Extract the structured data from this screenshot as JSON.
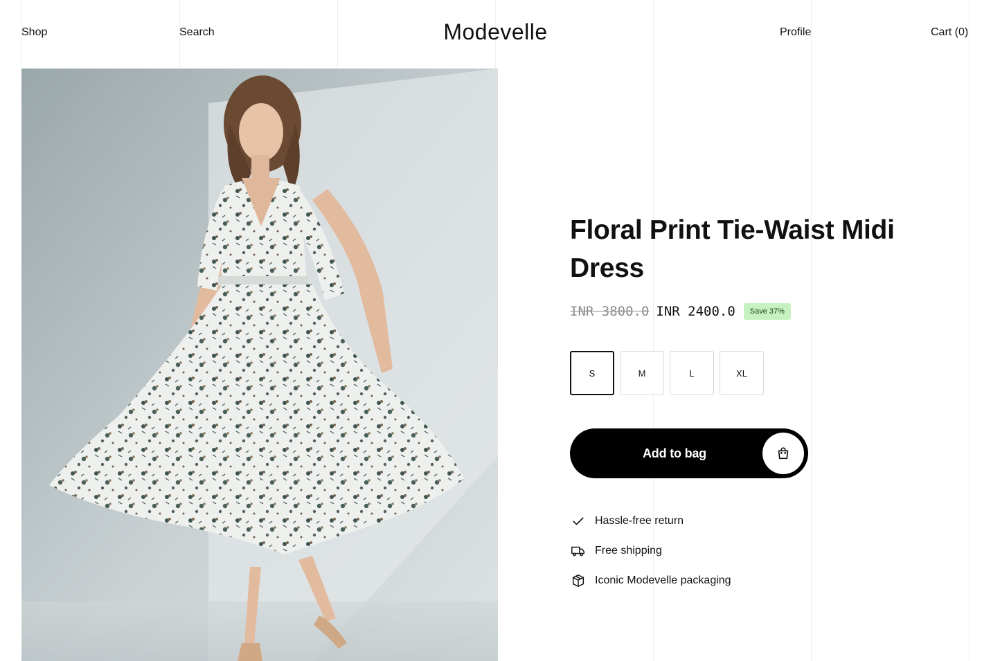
{
  "header": {
    "nav_left": [
      "Shop",
      "Search"
    ],
    "brand": "Modevelle",
    "nav_right": [
      "Profile",
      "Cart (0)"
    ]
  },
  "product": {
    "title": "Floral Print Tie-Waist Midi Dress",
    "price_original": "INR 3800.0",
    "price_current": "INR 2400.0",
    "save_badge": "Save 37%",
    "sizes": [
      "S",
      "M",
      "L",
      "XL"
    ],
    "selected_size": "S",
    "add_to_bag_label": "Add to bag"
  },
  "features": [
    {
      "icon": "check-icon",
      "text": "Hassle-free return"
    },
    {
      "icon": "truck-icon",
      "text": "Free shipping"
    },
    {
      "icon": "box-icon",
      "text": "Iconic Modevelle packaging"
    }
  ],
  "colors": {
    "background": "#ffffff",
    "text": "#111111",
    "button": "#000000",
    "badge_bg": "#c6f2c2",
    "grid_line": "#efefef"
  }
}
